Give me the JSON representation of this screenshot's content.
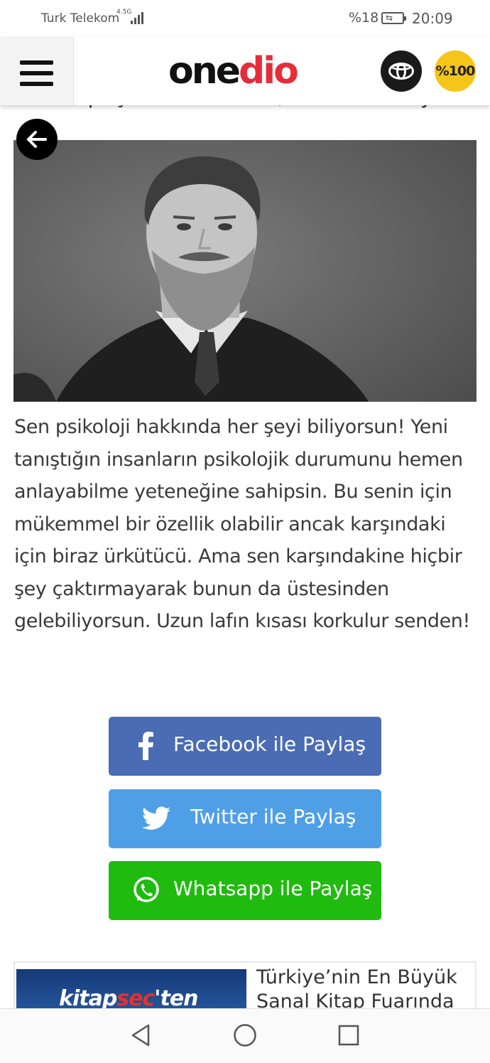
{
  "status_bar": {
    "carrier": "Turk Telekom",
    "network": "4.5G",
    "battery_percent": "%18",
    "time": "20:09"
  },
  "header": {
    "logo_one": "one",
    "logo_dio": "dio",
    "badge_pct": "%100",
    "toyota_icon": "toyota-logo-icon",
    "menu_icon": "hamburger-menu-icon",
    "brand_color": "#e52d3a"
  },
  "content": {
    "peek_text": "Sen hep içten ve samimi, herkesi anlayan birisin",
    "back_icon": "arrow-left-icon",
    "photo_alt": "",
    "result_text": "Sen psikoloji hakkında her şeyi biliyorsun! Yeni tanıştığın insanların psikolojik durumunu hemen anlayabilme yeteneğine sahipsin. Bu senin için mükemmel bir özellik olabilir ancak karşındaki için biraz ürkütücü. Ama sen karşındakine hiçbir şey çaktırmayarak bunun da üstesinden gelebiliyorsun. Uzun lafın kısası korkulur senden!"
  },
  "share": {
    "facebook_label": "Facebook ile Paylaş",
    "twitter_label": "Twitter ile Paylaş",
    "whatsapp_label": "Whatsapp ile Paylaş",
    "facebook_color": "#4a6cb4",
    "twitter_color": "#4f9fe6",
    "whatsapp_color": "#1fbb0e"
  },
  "promo": {
    "thumb_text_a": "kitap",
    "thumb_text_b": "sec",
    "thumb_text_c": "'ten",
    "title": "Türkiye’nin En Büyük Sanal Kitap Fuarında"
  },
  "nav_bar": {
    "back_icon": "triangle-back-icon",
    "home_icon": "circle-home-icon",
    "recents_icon": "square-recents-icon"
  }
}
